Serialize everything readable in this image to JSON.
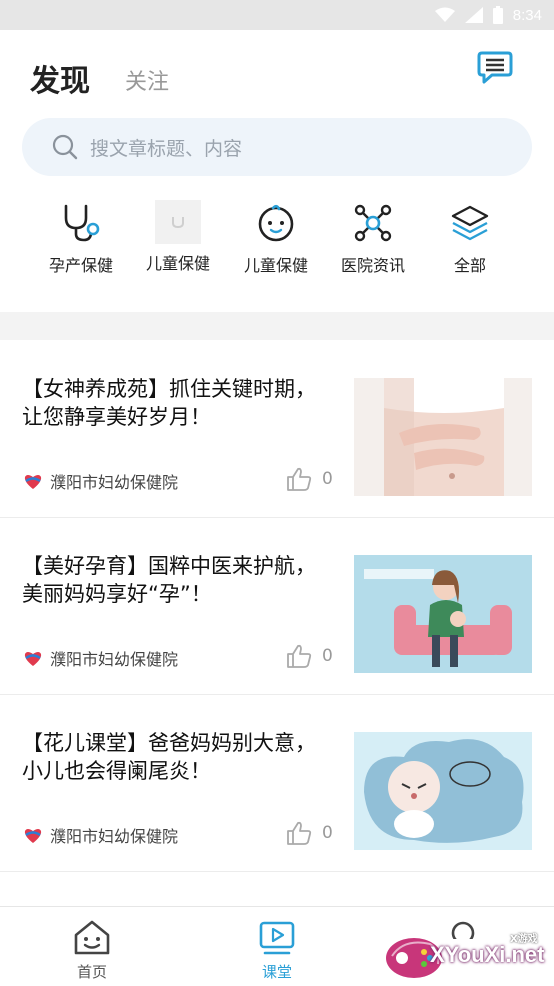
{
  "status_bar": {
    "time": "8:34"
  },
  "header": {
    "tab_discover": "发现",
    "tab_follow": "关注"
  },
  "search": {
    "placeholder": "搜文章标题、内容"
  },
  "categories": [
    {
      "label": "孕产保健",
      "icon": "stethoscope-icon"
    },
    {
      "label": "儿童保健",
      "icon": "placeholder-image-icon"
    },
    {
      "label": "儿童保健",
      "icon": "baby-face-icon"
    },
    {
      "label": "医院资讯",
      "icon": "network-nodes-icon"
    },
    {
      "label": "全部",
      "icon": "layers-icon"
    }
  ],
  "articles": [
    {
      "title": "【女神养成苑】抓住关键时期，让您静享美好岁月！",
      "source": "濮阳市妇幼保健院",
      "likes": "0"
    },
    {
      "title": "【美好孕育】国粹中医来护航，美丽妈妈享好“孕”！",
      "source": "濮阳市妇幼保健院",
      "likes": "0"
    },
    {
      "title": "【花儿课堂】爸爸妈妈别大意，小儿也会得阑尾炎！",
      "source": "濮阳市妇幼保健院",
      "likes": "0"
    }
  ],
  "bottom_nav": [
    {
      "label": "首页",
      "icon": "home-face-icon",
      "active": false
    },
    {
      "label": "课堂",
      "icon": "video-lesson-icon",
      "active": true
    }
  ],
  "colors": {
    "accent": "#2a9fd6",
    "search_bg": "#eef4fa",
    "band": "#f3f3f3"
  },
  "watermark": {
    "text": "XYouXi.net",
    "small": "X游戏"
  }
}
